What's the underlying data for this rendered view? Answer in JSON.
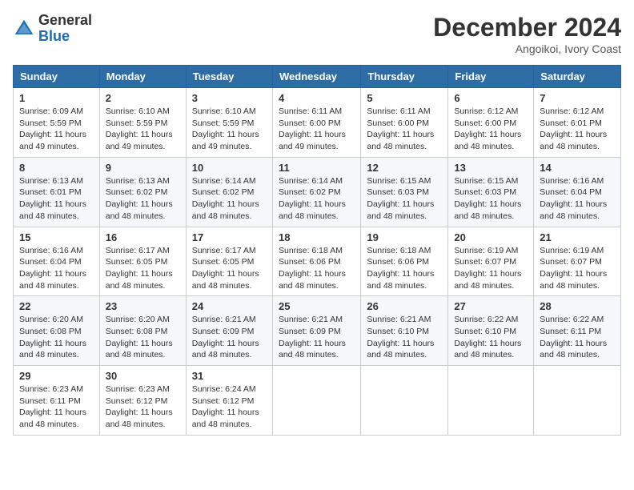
{
  "header": {
    "logo_text_general": "General",
    "logo_text_blue": "Blue",
    "month_year": "December 2024",
    "location": "Angoikoi, Ivory Coast"
  },
  "calendar": {
    "days_of_week": [
      "Sunday",
      "Monday",
      "Tuesday",
      "Wednesday",
      "Thursday",
      "Friday",
      "Saturday"
    ],
    "weeks": [
      [
        {
          "day": "1",
          "sunrise": "6:09 AM",
          "sunset": "5:59 PM",
          "daylight": "11 hours and 49 minutes."
        },
        {
          "day": "2",
          "sunrise": "6:10 AM",
          "sunset": "5:59 PM",
          "daylight": "11 hours and 49 minutes."
        },
        {
          "day": "3",
          "sunrise": "6:10 AM",
          "sunset": "5:59 PM",
          "daylight": "11 hours and 49 minutes."
        },
        {
          "day": "4",
          "sunrise": "6:11 AM",
          "sunset": "6:00 PM",
          "daylight": "11 hours and 49 minutes."
        },
        {
          "day": "5",
          "sunrise": "6:11 AM",
          "sunset": "6:00 PM",
          "daylight": "11 hours and 48 minutes."
        },
        {
          "day": "6",
          "sunrise": "6:12 AM",
          "sunset": "6:00 PM",
          "daylight": "11 hours and 48 minutes."
        },
        {
          "day": "7",
          "sunrise": "6:12 AM",
          "sunset": "6:01 PM",
          "daylight": "11 hours and 48 minutes."
        }
      ],
      [
        {
          "day": "8",
          "sunrise": "6:13 AM",
          "sunset": "6:01 PM",
          "daylight": "11 hours and 48 minutes."
        },
        {
          "day": "9",
          "sunrise": "6:13 AM",
          "sunset": "6:02 PM",
          "daylight": "11 hours and 48 minutes."
        },
        {
          "day": "10",
          "sunrise": "6:14 AM",
          "sunset": "6:02 PM",
          "daylight": "11 hours and 48 minutes."
        },
        {
          "day": "11",
          "sunrise": "6:14 AM",
          "sunset": "6:02 PM",
          "daylight": "11 hours and 48 minutes."
        },
        {
          "day": "12",
          "sunrise": "6:15 AM",
          "sunset": "6:03 PM",
          "daylight": "11 hours and 48 minutes."
        },
        {
          "day": "13",
          "sunrise": "6:15 AM",
          "sunset": "6:03 PM",
          "daylight": "11 hours and 48 minutes."
        },
        {
          "day": "14",
          "sunrise": "6:16 AM",
          "sunset": "6:04 PM",
          "daylight": "11 hours and 48 minutes."
        }
      ],
      [
        {
          "day": "15",
          "sunrise": "6:16 AM",
          "sunset": "6:04 PM",
          "daylight": "11 hours and 48 minutes."
        },
        {
          "day": "16",
          "sunrise": "6:17 AM",
          "sunset": "6:05 PM",
          "daylight": "11 hours and 48 minutes."
        },
        {
          "day": "17",
          "sunrise": "6:17 AM",
          "sunset": "6:05 PM",
          "daylight": "11 hours and 48 minutes."
        },
        {
          "day": "18",
          "sunrise": "6:18 AM",
          "sunset": "6:06 PM",
          "daylight": "11 hours and 48 minutes."
        },
        {
          "day": "19",
          "sunrise": "6:18 AM",
          "sunset": "6:06 PM",
          "daylight": "11 hours and 48 minutes."
        },
        {
          "day": "20",
          "sunrise": "6:19 AM",
          "sunset": "6:07 PM",
          "daylight": "11 hours and 48 minutes."
        },
        {
          "day": "21",
          "sunrise": "6:19 AM",
          "sunset": "6:07 PM",
          "daylight": "11 hours and 48 minutes."
        }
      ],
      [
        {
          "day": "22",
          "sunrise": "6:20 AM",
          "sunset": "6:08 PM",
          "daylight": "11 hours and 48 minutes."
        },
        {
          "day": "23",
          "sunrise": "6:20 AM",
          "sunset": "6:08 PM",
          "daylight": "11 hours and 48 minutes."
        },
        {
          "day": "24",
          "sunrise": "6:21 AM",
          "sunset": "6:09 PM",
          "daylight": "11 hours and 48 minutes."
        },
        {
          "day": "25",
          "sunrise": "6:21 AM",
          "sunset": "6:09 PM",
          "daylight": "11 hours and 48 minutes."
        },
        {
          "day": "26",
          "sunrise": "6:21 AM",
          "sunset": "6:10 PM",
          "daylight": "11 hours and 48 minutes."
        },
        {
          "day": "27",
          "sunrise": "6:22 AM",
          "sunset": "6:10 PM",
          "daylight": "11 hours and 48 minutes."
        },
        {
          "day": "28",
          "sunrise": "6:22 AM",
          "sunset": "6:11 PM",
          "daylight": "11 hours and 48 minutes."
        }
      ],
      [
        {
          "day": "29",
          "sunrise": "6:23 AM",
          "sunset": "6:11 PM",
          "daylight": "11 hours and 48 minutes."
        },
        {
          "day": "30",
          "sunrise": "6:23 AM",
          "sunset": "6:12 PM",
          "daylight": "11 hours and 48 minutes."
        },
        {
          "day": "31",
          "sunrise": "6:24 AM",
          "sunset": "6:12 PM",
          "daylight": "11 hours and 48 minutes."
        },
        null,
        null,
        null,
        null
      ]
    ]
  }
}
